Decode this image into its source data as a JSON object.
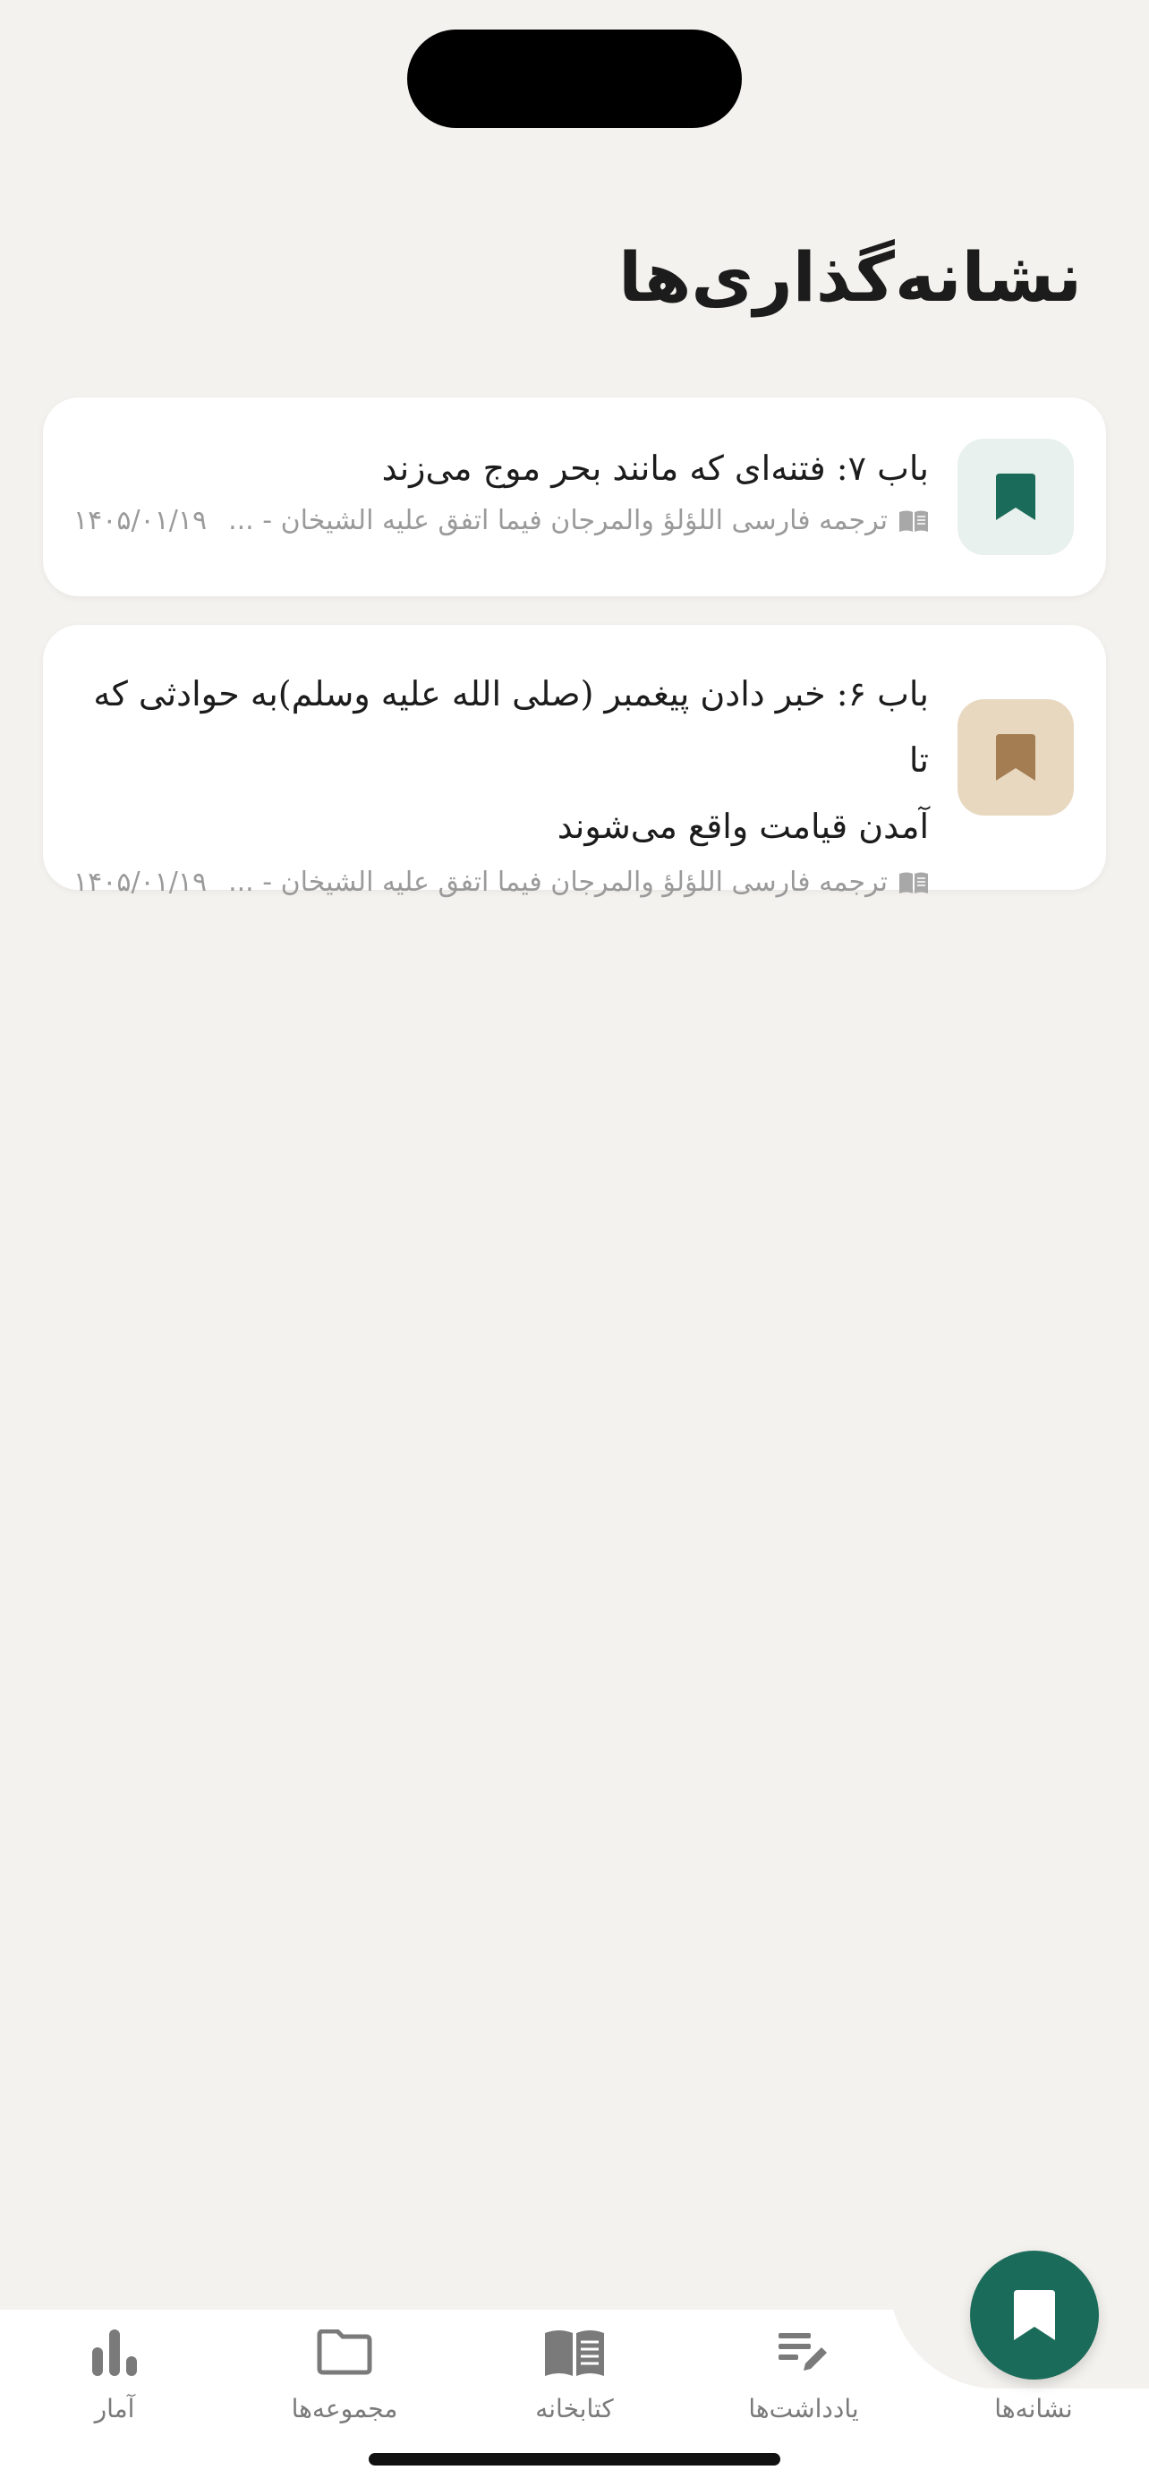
{
  "page": {
    "title": "نشانه‌گذاری‌ها"
  },
  "bookmarks": [
    {
      "title": "باب ۷: فتنه‌ای  که مانند بحر موج می‌زند",
      "source": "ترجمه فارسی اللؤلؤ والمرجان فیما اتفق علیه الشیخان - ...",
      "date": "۱۴۰۵/۰۱/۱۹",
      "icon": "bookmark-icon",
      "color": "#1b6b5a",
      "icon_bg": "#e8f1ed"
    },
    {
      "title_line1": "باب ۶: خبر دادن پیغمبر  (صلی الله علیه وسلم)به حوادثی که تا",
      "title_line2": "آمدن قیامت واقع می‌شوند",
      "source": "ترجمه فارسی اللؤلؤ والمرجان فیما اتفق علیه الشیخان - ...",
      "date": "۱۴۰۵/۰۱/۱۹",
      "icon": "bookmark-icon",
      "color": "#a47e52",
      "icon_bg": "#e8d8c0"
    }
  ],
  "tabbar": {
    "tabs": [
      {
        "label": "نشانه‌ها",
        "icon": "bookmark-icon",
        "active": true
      },
      {
        "label": "یادداشت‌ها",
        "icon": "note-edit-icon"
      },
      {
        "label": "کتابخانه",
        "icon": "book-open-icon"
      },
      {
        "label": "مجموعه‌ها",
        "icon": "folder-icon"
      },
      {
        "label": "آمار",
        "icon": "bar-chart-icon"
      }
    ],
    "accent": "#1b6b5a",
    "inactive_color": "#7a7a7a"
  }
}
